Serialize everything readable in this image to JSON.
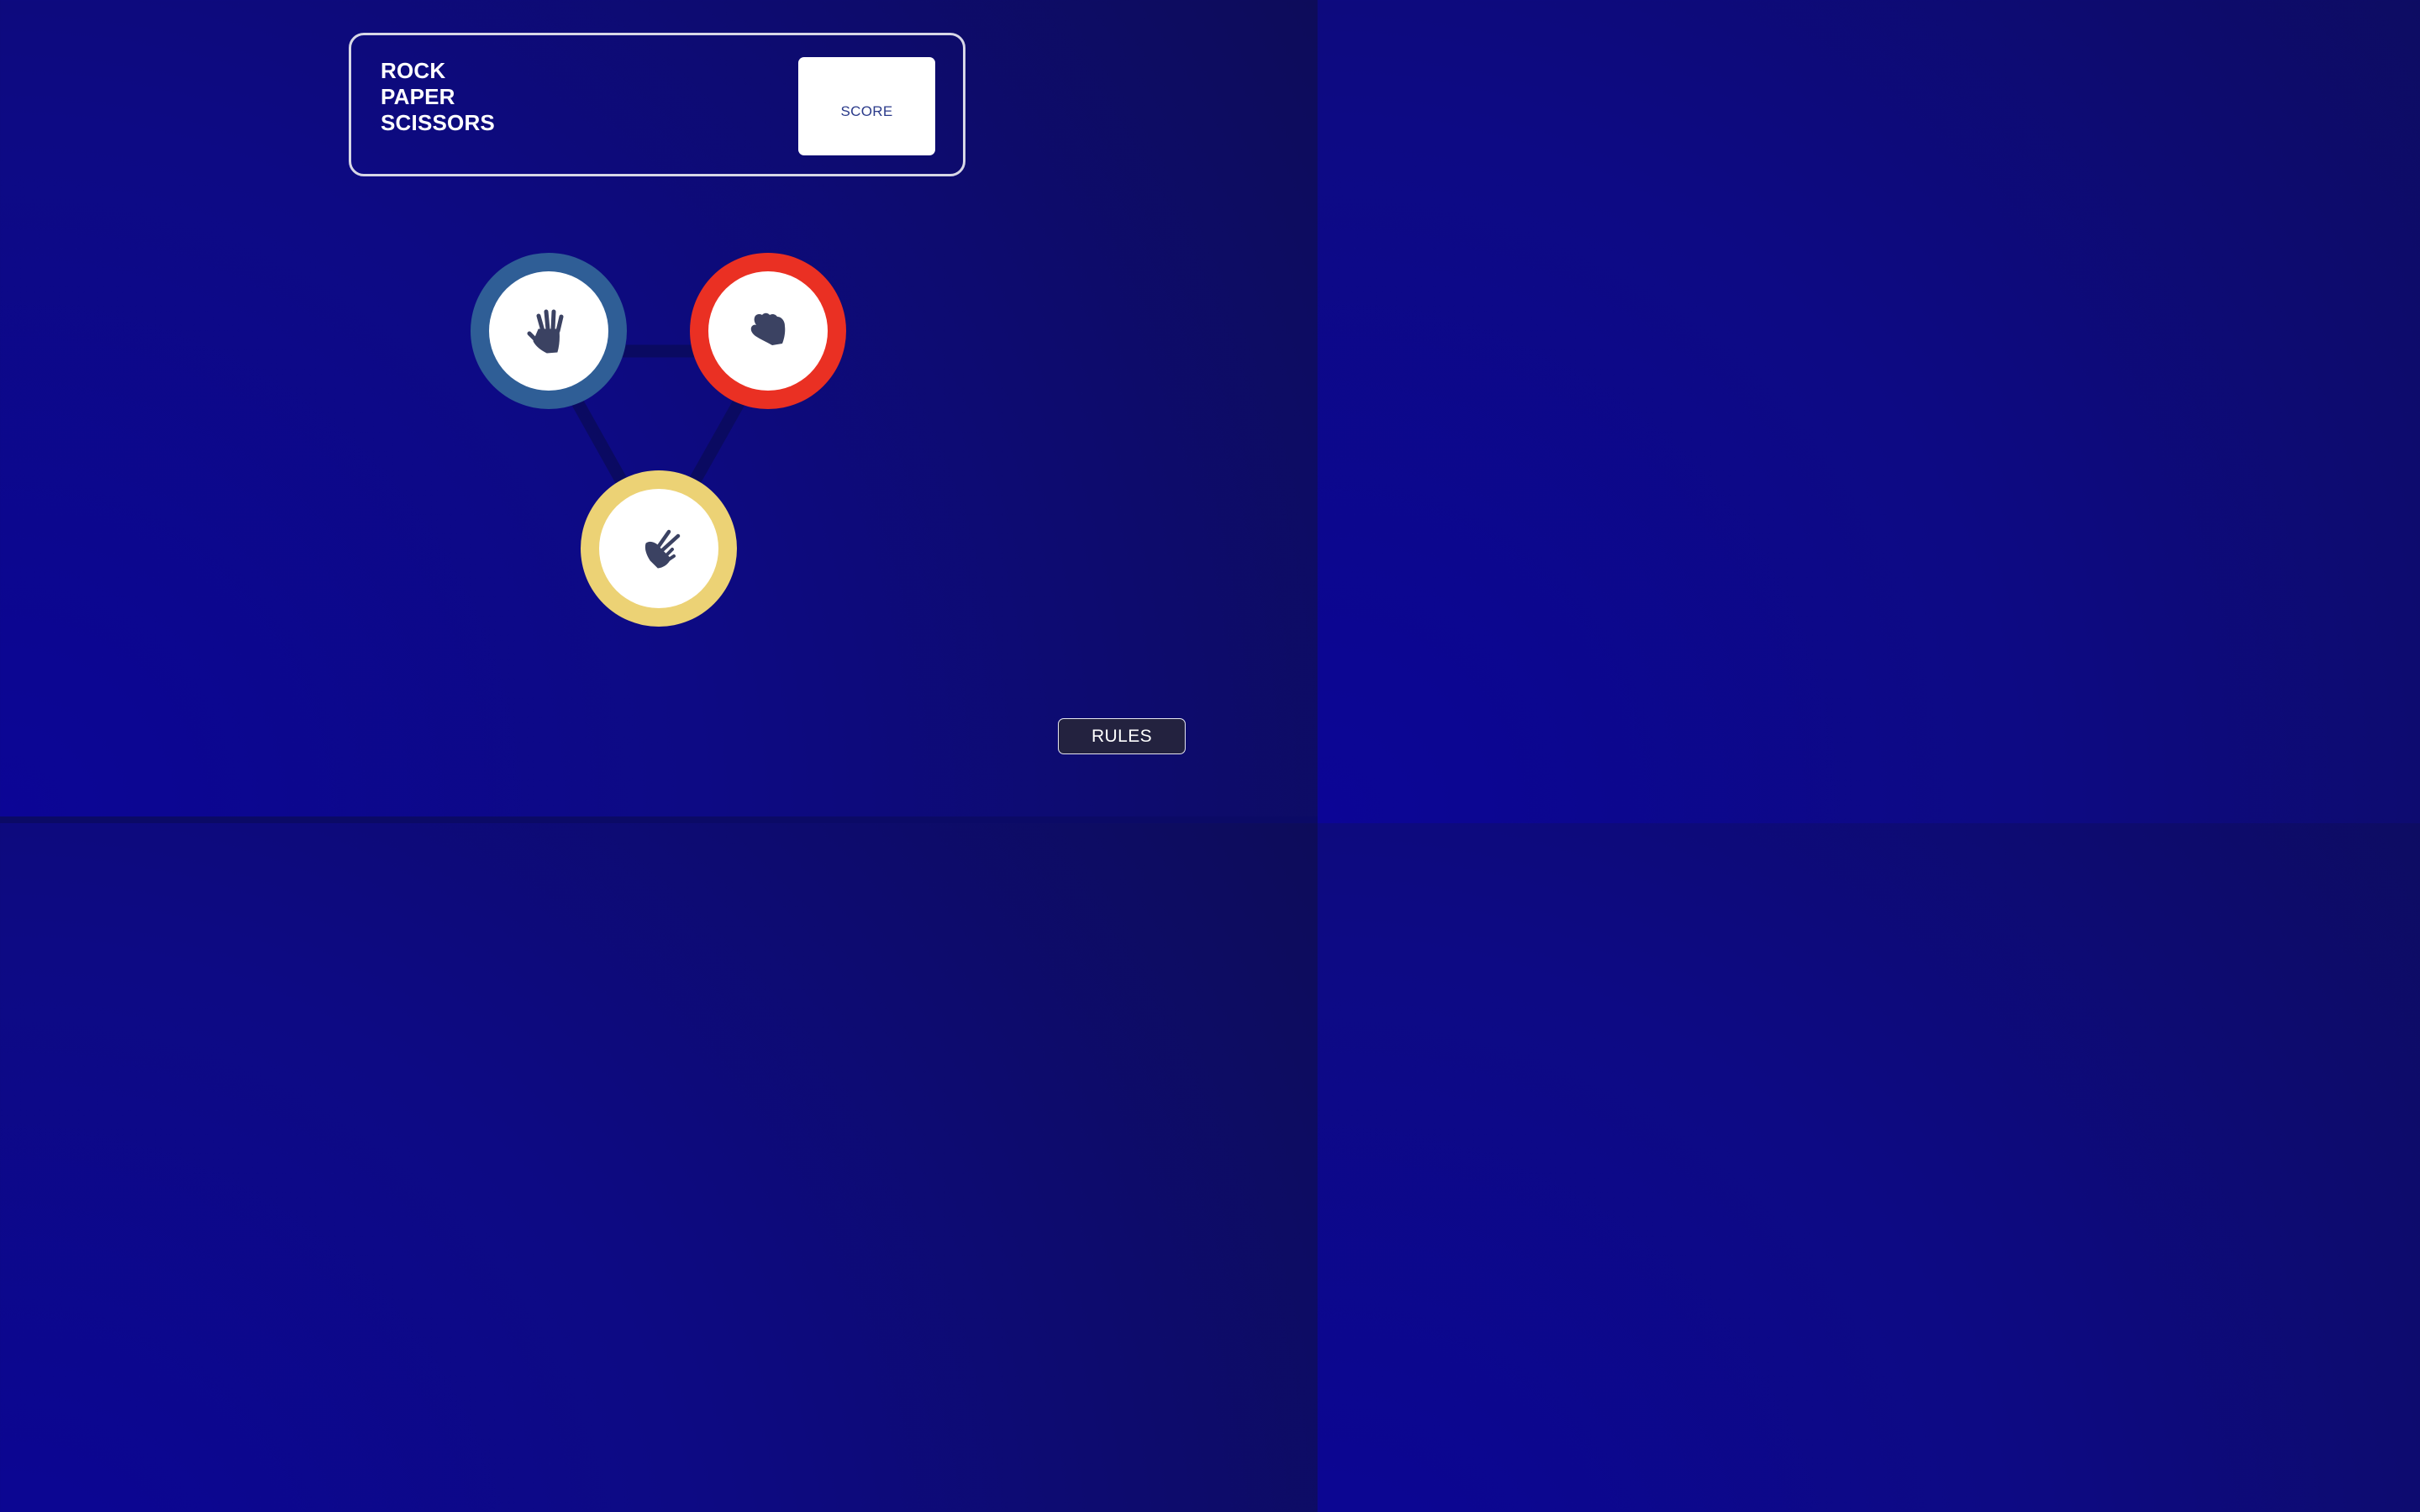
{
  "header": {
    "title_lines": [
      "ROCK",
      "PAPER",
      "SCISSORS"
    ],
    "score_label": "SCORE"
  },
  "choices": [
    {
      "name": "paper",
      "icon": "paper-hand-icon",
      "ring_color": "#2f5e96"
    },
    {
      "name": "rock",
      "icon": "rock-fist-icon",
      "ring_color": "#ea3023"
    },
    {
      "name": "scissors",
      "icon": "scissors-hand-icon",
      "ring_color": "#ecd275"
    }
  ],
  "rules_button": {
    "label": "RULES"
  },
  "colors": {
    "background_dark": "#0d0c5a",
    "background_bright": "#0c0596",
    "icon": "#3b4262",
    "triangle": "#0b0a5c",
    "rules_bg": "#23223f"
  }
}
